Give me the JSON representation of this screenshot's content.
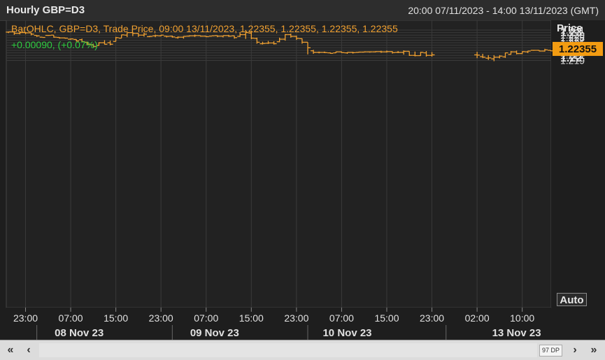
{
  "header": {
    "title": "Hourly GBP=D3",
    "date_range": "20:00 07/11/2023 - 14:00 13/11/2023 (GMT)"
  },
  "legend": {
    "line1": "BarOHLC, GBP=D3, Trade Price, 09:00 13/11/2023, 1.22355, 1.22355, 1.22355, 1.22355",
    "line2": "+0.00090, (+0.07%)"
  },
  "price_axis": {
    "header": "Price",
    "current_price_label": "1.22355",
    "auto_label": "Auto"
  },
  "scrollbar": {
    "first_label": "«",
    "prev_label": "‹",
    "next_label": "›",
    "last_label": "»",
    "dp_label": "97 DP"
  },
  "colors": {
    "background": "#222222",
    "bars": "#f0a030",
    "grid": "#3a3a3a",
    "positive_change": "#2ecc40",
    "current_price_tag": "#f39c12"
  },
  "chart_data": {
    "type": "bar",
    "subtype": "ohlc",
    "title": "Hourly GBP=D3",
    "ylabel": "Price",
    "ylim": [
      1.2184,
      1.2315
    ],
    "grid": true,
    "y_ticks": [
      {
        "value": 1.231,
        "label": "1.231",
        "major": false
      },
      {
        "value": 1.23,
        "label": "1.23",
        "major": true
      },
      {
        "value": 1.229,
        "label": "1.229",
        "major": false
      },
      {
        "value": 1.228,
        "label": "1.228",
        "major": false
      },
      {
        "value": 1.227,
        "label": "1.227",
        "major": false
      },
      {
        "value": 1.226,
        "label": "1.226",
        "major": false
      },
      {
        "value": 1.225,
        "label": "1.225",
        "major": false
      },
      {
        "value": 1.224,
        "label": "1.224",
        "major": false
      },
      {
        "value": 1.223,
        "label": "1.223",
        "major": false
      },
      {
        "value": 1.222,
        "label": "1.222",
        "major": false
      },
      {
        "value": 1.221,
        "label": "1.221",
        "major": false
      },
      {
        "value": 1.22,
        "label": "1.22",
        "major": true
      },
      {
        "value": 1.219,
        "label": "1.219",
        "major": false
      }
    ],
    "x_ticks": [
      {
        "index": 3,
        "label": "23:00"
      },
      {
        "index": 11,
        "label": "07:00"
      },
      {
        "index": 19,
        "label": "15:00"
      },
      {
        "index": 27,
        "label": "23:00"
      },
      {
        "index": 35,
        "label": "07:00"
      },
      {
        "index": 43,
        "label": "15:00"
      },
      {
        "index": 51,
        "label": "23:00"
      },
      {
        "index": 59,
        "label": "07:00"
      },
      {
        "index": 67,
        "label": "15:00"
      },
      {
        "index": 75,
        "label": "23:00"
      },
      {
        "index": 83,
        "label": "02:00"
      },
      {
        "index": 91,
        "label": "10:00"
      }
    ],
    "x_date_labels": [
      {
        "index": 12.5,
        "label": "08 Nov 23"
      },
      {
        "index": 36.5,
        "label": "09 Nov 23"
      },
      {
        "index": 60,
        "label": "10 Nov 23"
      },
      {
        "index": 90,
        "label": "13 Nov 23"
      }
    ],
    "day_separators": [
      5,
      29,
      53,
      77.5
    ],
    "last_price": 1.22355,
    "ohlc": [
      [
        1.2302,
        1.2304,
        1.2298,
        1.2303
      ],
      [
        1.2303,
        1.2306,
        1.2291,
        1.2297
      ],
      [
        1.2297,
        1.2304,
        1.2293,
        1.23
      ],
      [
        1.23,
        1.2303,
        1.2294,
        1.2299
      ],
      [
        1.2299,
        1.2299,
        1.2289,
        1.2294
      ],
      [
        1.2289,
        1.2289,
        1.2283,
        1.2287
      ],
      [
        1.2282,
        1.2282,
        1.2281,
        1.2281
      ],
      [
        1.2289,
        1.229,
        1.2287,
        1.2289
      ],
      [
        1.229,
        1.229,
        1.228,
        1.2282
      ],
      [
        1.2281,
        1.2282,
        1.2276,
        1.2279
      ],
      [
        1.2279,
        1.228,
        1.2276,
        1.2278
      ],
      [
        1.2274,
        1.2277,
        1.2272,
        1.2275
      ],
      [
        1.2273,
        1.2274,
        1.2265,
        1.2267
      ],
      [
        1.2272,
        1.2276,
        1.2263,
        1.2264
      ],
      [
        1.2262,
        1.2263,
        1.2252,
        1.2254
      ],
      [
        1.2252,
        1.2256,
        1.2242,
        1.2245
      ],
      [
        1.2249,
        1.2262,
        1.2248,
        1.226
      ],
      [
        1.226,
        1.227,
        1.2253,
        1.2254
      ],
      [
        1.226,
        1.2268,
        1.225,
        1.2254
      ],
      [
        1.2265,
        1.2283,
        1.2265,
        1.228
      ],
      [
        1.2278,
        1.2292,
        1.2278,
        1.2291
      ],
      [
        1.229,
        1.2301,
        1.2282,
        1.23
      ],
      [
        1.23,
        1.2302,
        1.2286,
        1.2297
      ],
      [
        1.2297,
        1.2298,
        1.2283,
        1.229
      ],
      [
        1.229,
        1.23,
        1.2284,
        1.2294
      ],
      [
        1.2284,
        1.2287,
        1.2282,
        1.2285
      ],
      [
        1.2287,
        1.2292,
        1.2282,
        1.2288
      ],
      [
        1.2287,
        1.229,
        1.2285,
        1.229
      ],
      [
        1.2286,
        1.2287,
        1.2281,
        1.2285
      ],
      [
        1.2286,
        1.2288,
        1.228,
        1.2283
      ],
      [
        1.228,
        1.2285,
        1.2276,
        1.2282
      ],
      [
        1.2282,
        1.2286,
        1.2276,
        1.2285
      ],
      [
        1.2286,
        1.2289,
        1.2284,
        1.2287
      ],
      [
        1.2287,
        1.2292,
        1.2283,
        1.2288
      ],
      [
        1.2288,
        1.2288,
        1.2284,
        1.2286
      ],
      [
        1.2286,
        1.2286,
        1.2282,
        1.2284
      ],
      [
        1.2286,
        1.2288,
        1.2286,
        1.2287
      ],
      [
        1.2288,
        1.2289,
        1.2282,
        1.2286
      ],
      [
        1.2286,
        1.2288,
        1.2281,
        1.2288
      ],
      [
        1.2288,
        1.2291,
        1.2283,
        1.2286
      ],
      [
        1.2287,
        1.2288,
        1.2276,
        1.228
      ],
      [
        1.2285,
        1.2302,
        1.2283,
        1.2292
      ],
      [
        1.2292,
        1.231,
        1.2275,
        1.23
      ],
      [
        1.2298,
        1.2308,
        1.2274,
        1.2278
      ],
      [
        1.2277,
        1.228,
        1.2256,
        1.2262
      ],
      [
        1.2256,
        1.2264,
        1.2253,
        1.2257
      ],
      [
        1.2258,
        1.2267,
        1.2255,
        1.2259
      ],
      [
        1.2259,
        1.2266,
        1.2253,
        1.2256
      ],
      [
        1.2264,
        1.228,
        1.2262,
        1.2274
      ],
      [
        1.2274,
        1.2294,
        1.2268,
        1.2292
      ],
      [
        1.2292,
        1.2296,
        1.228,
        1.2285
      ],
      [
        1.2285,
        1.2288,
        1.2271,
        1.2277
      ],
      [
        1.2276,
        1.2277,
        1.2256,
        1.2262
      ],
      [
        1.2262,
        1.2262,
        1.2214,
        1.224
      ],
      [
        1.2228,
        1.2232,
        1.2216,
        1.2222
      ],
      [
        1.2222,
        1.2225,
        1.2218,
        1.2222
      ],
      [
        1.2222,
        1.2225,
        1.2219,
        1.2221
      ],
      [
        1.222,
        1.2222,
        1.2217,
        1.2218
      ],
      [
        1.222,
        1.2225,
        1.2219,
        1.2224
      ],
      [
        1.2224,
        1.2225,
        1.222,
        1.2221
      ],
      [
        1.222,
        1.2222,
        1.2216,
        1.2222
      ],
      [
        1.2222,
        1.2224,
        1.2217,
        1.2221
      ],
      [
        1.2222,
        1.2224,
        1.2221,
        1.2223
      ],
      [
        1.2223,
        1.2225,
        1.2222,
        1.2224
      ],
      [
        1.2224,
        1.2225,
        1.2221,
        1.2224
      ],
      [
        1.2224,
        1.2226,
        1.2222,
        1.2225
      ],
      [
        1.2225,
        1.2228,
        1.222,
        1.2224
      ],
      [
        1.2224,
        1.2229,
        1.2221,
        1.2225
      ],
      [
        1.2225,
        1.2226,
        1.2217,
        1.2221
      ],
      [
        1.2222,
        1.2227,
        1.2219,
        1.2222
      ],
      [
        1.2222,
        1.223,
        1.2213,
        1.2226
      ],
      [
        1.2226,
        1.2226,
        1.2208,
        1.221
      ],
      [
        1.221,
        1.2225,
        1.2206,
        1.2209
      ],
      [
        1.2209,
        1.2224,
        1.2208,
        1.2222
      ],
      [
        1.222,
        1.2227,
        1.2205,
        1.221
      ],
      [
        1.221,
        1.2223,
        1.2205,
        1.2212
      ],
      [
        1.2212,
        1.2224,
        1.2199,
        1.2211
      ],
      [
        1.2205,
        1.2216,
        1.2199,
        1.2203
      ],
      [
        1.2199,
        1.2211,
        1.2192,
        1.22
      ],
      [
        1.2196,
        1.2211,
        1.2187,
        1.2203
      ],
      [
        1.2203,
        1.2211,
        1.2198,
        1.2207
      ],
      [
        1.2204,
        1.2221,
        1.22,
        1.222
      ],
      [
        1.2214,
        1.2227,
        1.2213,
        1.2224
      ],
      [
        1.2224,
        1.2229,
        1.2214,
        1.2217
      ],
      [
        1.2217,
        1.2226,
        1.2215,
        1.2225
      ],
      [
        1.2224,
        1.2228,
        1.2219,
        1.2227
      ],
      [
        1.223,
        1.2231,
        1.2228,
        1.223
      ],
      [
        1.223,
        1.2231,
        1.2226,
        1.2227
      ],
      [
        1.2227,
        1.2236,
        1.2225,
        1.2232
      ],
      [
        1.223,
        1.2231,
        1.2227,
        1.2228
      ],
      [
        1.2228,
        1.2231,
        1.2224,
        1.2229
      ],
      [
        1.223,
        1.2233,
        1.2229,
        1.223
      ],
      [
        1.223,
        1.2232,
        1.223,
        1.2231
      ],
      [
        1.224,
        1.2242,
        1.2237,
        1.2238
      ],
      [
        1.2238,
        1.224,
        1.2235,
        1.2236
      ],
      [
        1.2236,
        1.2236,
        1.22355,
        1.22355
      ],
      [
        1.22355,
        1.22355,
        1.22355,
        1.22355
      ]
    ]
  }
}
